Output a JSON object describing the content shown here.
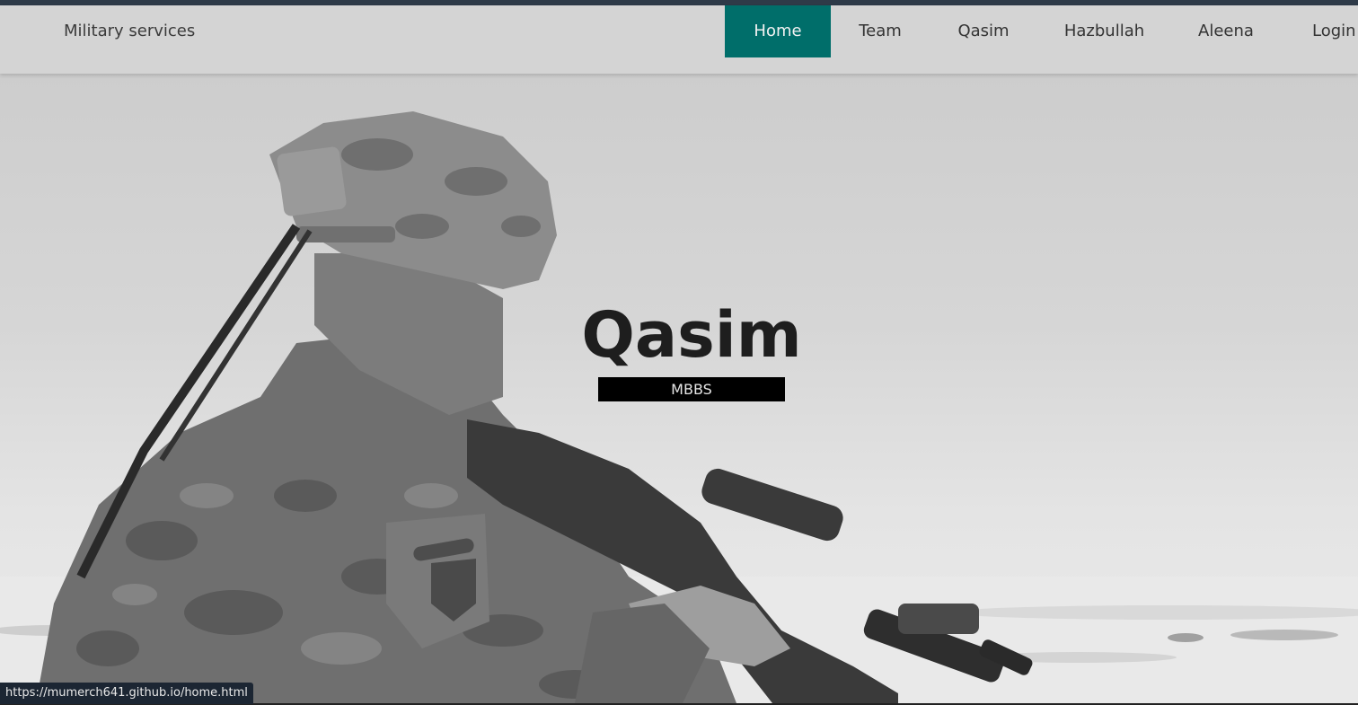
{
  "accent": "#006e6a",
  "navbar": {
    "brand": "Military services",
    "items": [
      {
        "label": "Home",
        "active": true
      },
      {
        "label": "Team",
        "active": false
      },
      {
        "label": "Qasim",
        "active": false
      },
      {
        "label": "Hazbullah",
        "active": false
      },
      {
        "label": "Aleena",
        "active": false
      },
      {
        "label": "Login",
        "active": false
      }
    ]
  },
  "hero": {
    "title": "Qasim",
    "badge": "MBBS",
    "image": "soldier-with-rifle-grayscale"
  },
  "status": {
    "url": "https://mumerch641.github.io/home.html"
  }
}
